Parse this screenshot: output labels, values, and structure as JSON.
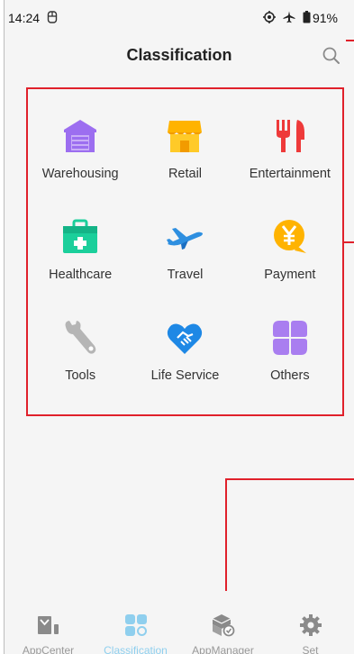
{
  "status": {
    "time": "14:24",
    "battery": "91%"
  },
  "header": {
    "title": "Classification"
  },
  "categories": [
    {
      "label": "Warehousing",
      "icon": "warehouse-icon",
      "color": "#9c6ef0"
    },
    {
      "label": "Retail",
      "icon": "shop-icon",
      "color": "#ffb300"
    },
    {
      "label": "Entertainment",
      "icon": "fork-knife-icon",
      "color": "#ee3a3a"
    },
    {
      "label": "Healthcare",
      "icon": "medical-kit-icon",
      "color": "#1bcf9b"
    },
    {
      "label": "Travel",
      "icon": "airplane-icon",
      "color": "#2e8fe0"
    },
    {
      "label": "Payment",
      "icon": "yen-coin-icon",
      "color": "#ffa726"
    },
    {
      "label": "Tools",
      "icon": "wrench-icon",
      "color": "#b5b5b5"
    },
    {
      "label": "Life Service",
      "icon": "handshake-heart-icon",
      "color": "#1e88e5"
    },
    {
      "label": "Others",
      "icon": "others-icon",
      "color": "#a97ef0"
    }
  ],
  "tabs": [
    {
      "label": "AppCenter",
      "icon": "app-center-icon",
      "active": false
    },
    {
      "label": "Classification",
      "icon": "classification-icon",
      "active": true
    },
    {
      "label": "AppManager",
      "icon": "app-manager-icon",
      "active": false
    },
    {
      "label": "Set",
      "icon": "gear-icon",
      "active": false
    }
  ]
}
